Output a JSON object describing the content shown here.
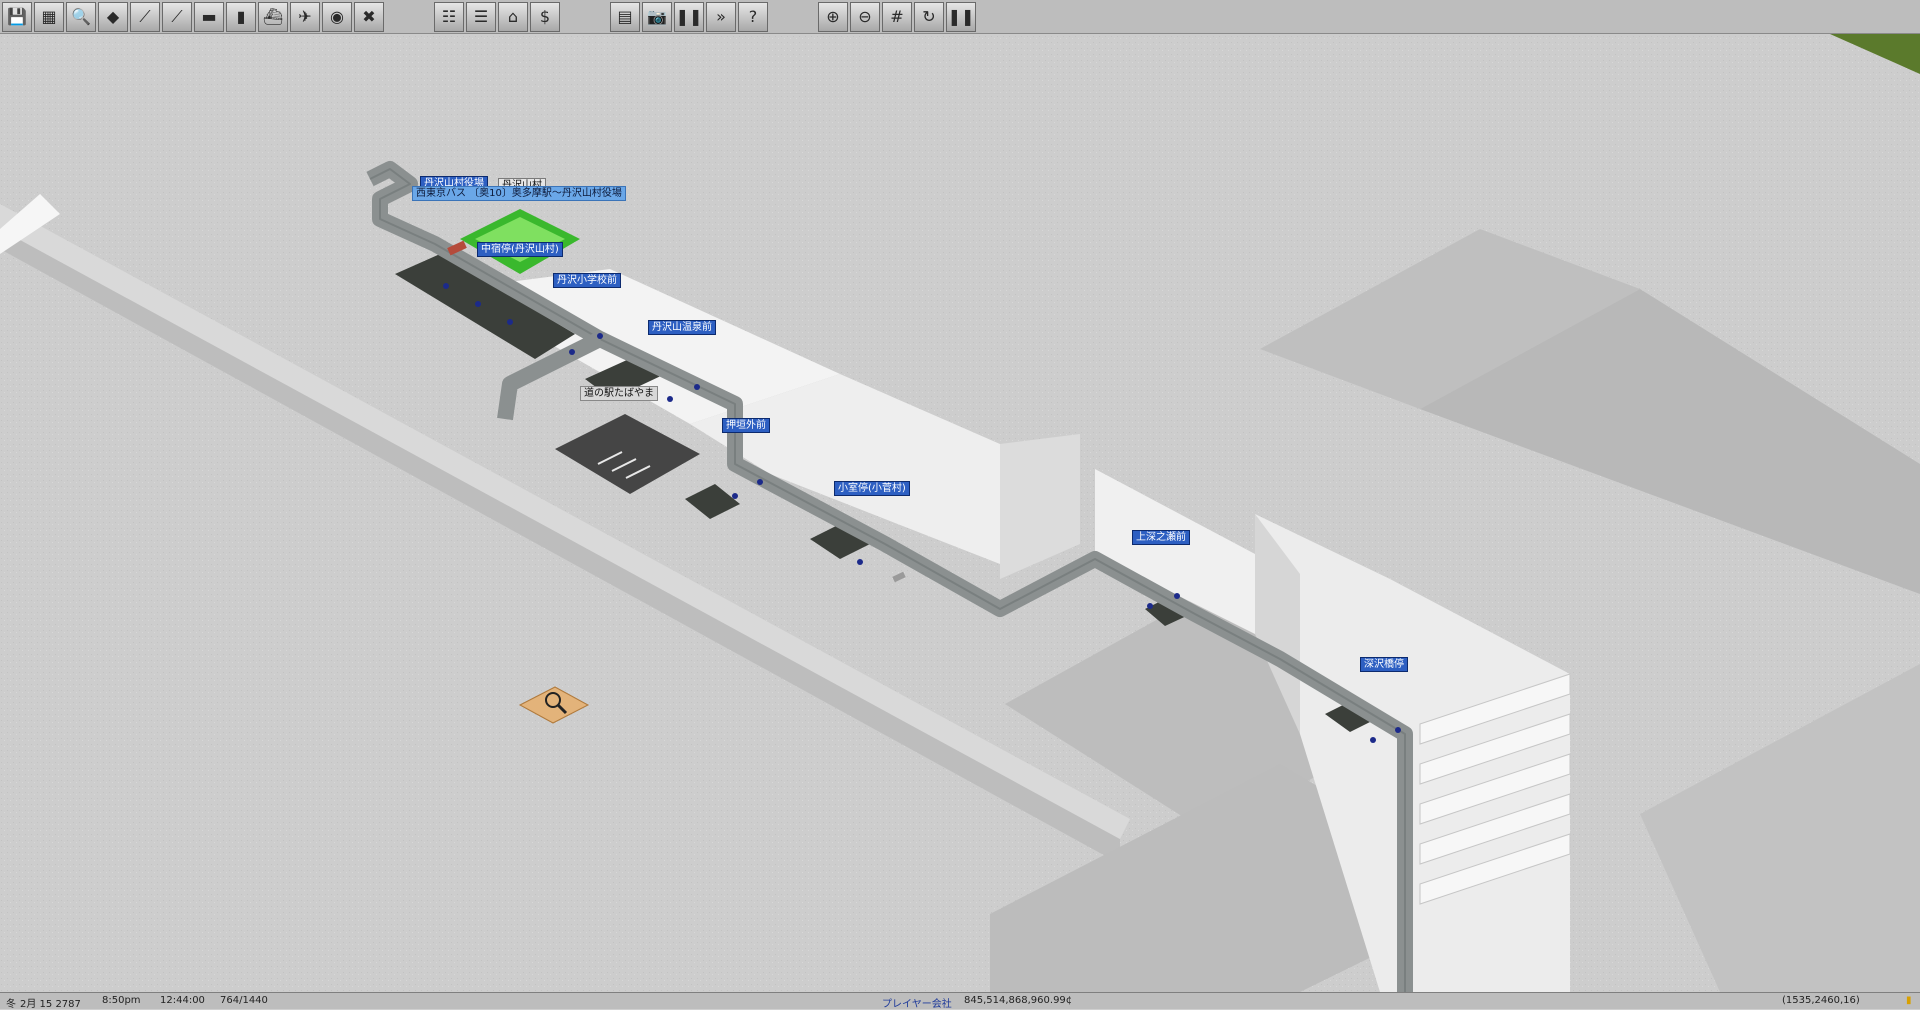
{
  "toolbar": {
    "group1": [
      {
        "icon": "save-icon",
        "glyph": "💾"
      },
      {
        "icon": "map-icon",
        "glyph": "▦"
      },
      {
        "icon": "magnifier-icon",
        "glyph": "🔍"
      },
      {
        "icon": "terrain-icon",
        "glyph": "◆"
      },
      {
        "icon": "rail-icon",
        "glyph": "⟋"
      },
      {
        "icon": "monorail-icon",
        "glyph": "⟋"
      },
      {
        "icon": "bus-icon",
        "glyph": "▬"
      },
      {
        "icon": "truck-icon",
        "glyph": "▮"
      },
      {
        "icon": "ship-icon",
        "glyph": "⛴"
      },
      {
        "icon": "airplane-icon",
        "glyph": "✈"
      },
      {
        "icon": "special-icon",
        "glyph": "◉"
      },
      {
        "icon": "remove-icon",
        "glyph": "✖"
      }
    ],
    "group2": [
      {
        "icon": "line-management-icon",
        "glyph": "☷"
      },
      {
        "icon": "list-icon",
        "glyph": "☰"
      },
      {
        "icon": "depot-icon",
        "glyph": "⌂"
      },
      {
        "icon": "finance-icon",
        "glyph": "$"
      }
    ],
    "group3": [
      {
        "icon": "minimap-icon",
        "glyph": "▤"
      },
      {
        "icon": "screenshot-icon",
        "glyph": "📷"
      },
      {
        "icon": "pause-icon",
        "glyph": "❚❚"
      },
      {
        "icon": "fast-forward-icon",
        "glyph": "»"
      },
      {
        "icon": "help-icon",
        "glyph": "?"
      }
    ],
    "group4": [
      {
        "icon": "zoom-in-icon",
        "glyph": "⊕"
      },
      {
        "icon": "zoom-out-icon",
        "glyph": "⊖"
      },
      {
        "icon": "grid-icon",
        "glyph": "#"
      },
      {
        "icon": "rotate-icon",
        "glyph": "↻"
      },
      {
        "icon": "pause2-icon",
        "glyph": "❚❚"
      }
    ]
  },
  "map": {
    "labels": [
      {
        "text": "丹沢山村役場",
        "kind": "stop"
      },
      {
        "text": "丹沢山村",
        "kind": "town"
      },
      {
        "text": "西東京バス 〔奥10〕奥多摩駅～丹沢山村役場",
        "kind": "line"
      },
      {
        "text": "中宿停(丹沢山村)",
        "kind": "stop"
      },
      {
        "text": "丹沢小学校前",
        "kind": "stop"
      },
      {
        "text": "丹沢山温泉前",
        "kind": "stop"
      },
      {
        "text": "道の駅たばやま",
        "kind": "road-sta"
      },
      {
        "text": "押垣外前",
        "kind": "stop"
      },
      {
        "text": "小室停(小菅村)",
        "kind": "stop"
      },
      {
        "text": "上深之瀬前",
        "kind": "stop"
      },
      {
        "text": "深沢橋停",
        "kind": "stop"
      }
    ]
  },
  "status": {
    "season": "冬",
    "date": "2月 15 2787",
    "clock": "8:50pm",
    "elapsed": "12:44:00",
    "progress": "764/1440",
    "player": "プレイヤー会社",
    "money": "845,514,868,960.99¢",
    "coords": "(1535,2460,16)"
  },
  "colors": {
    "ground": "#cfcfcf",
    "snow": "#f4f4f4",
    "road": "#8a8f8f",
    "stop_label": "#2d5fc2",
    "grass": "#3ab82d"
  }
}
